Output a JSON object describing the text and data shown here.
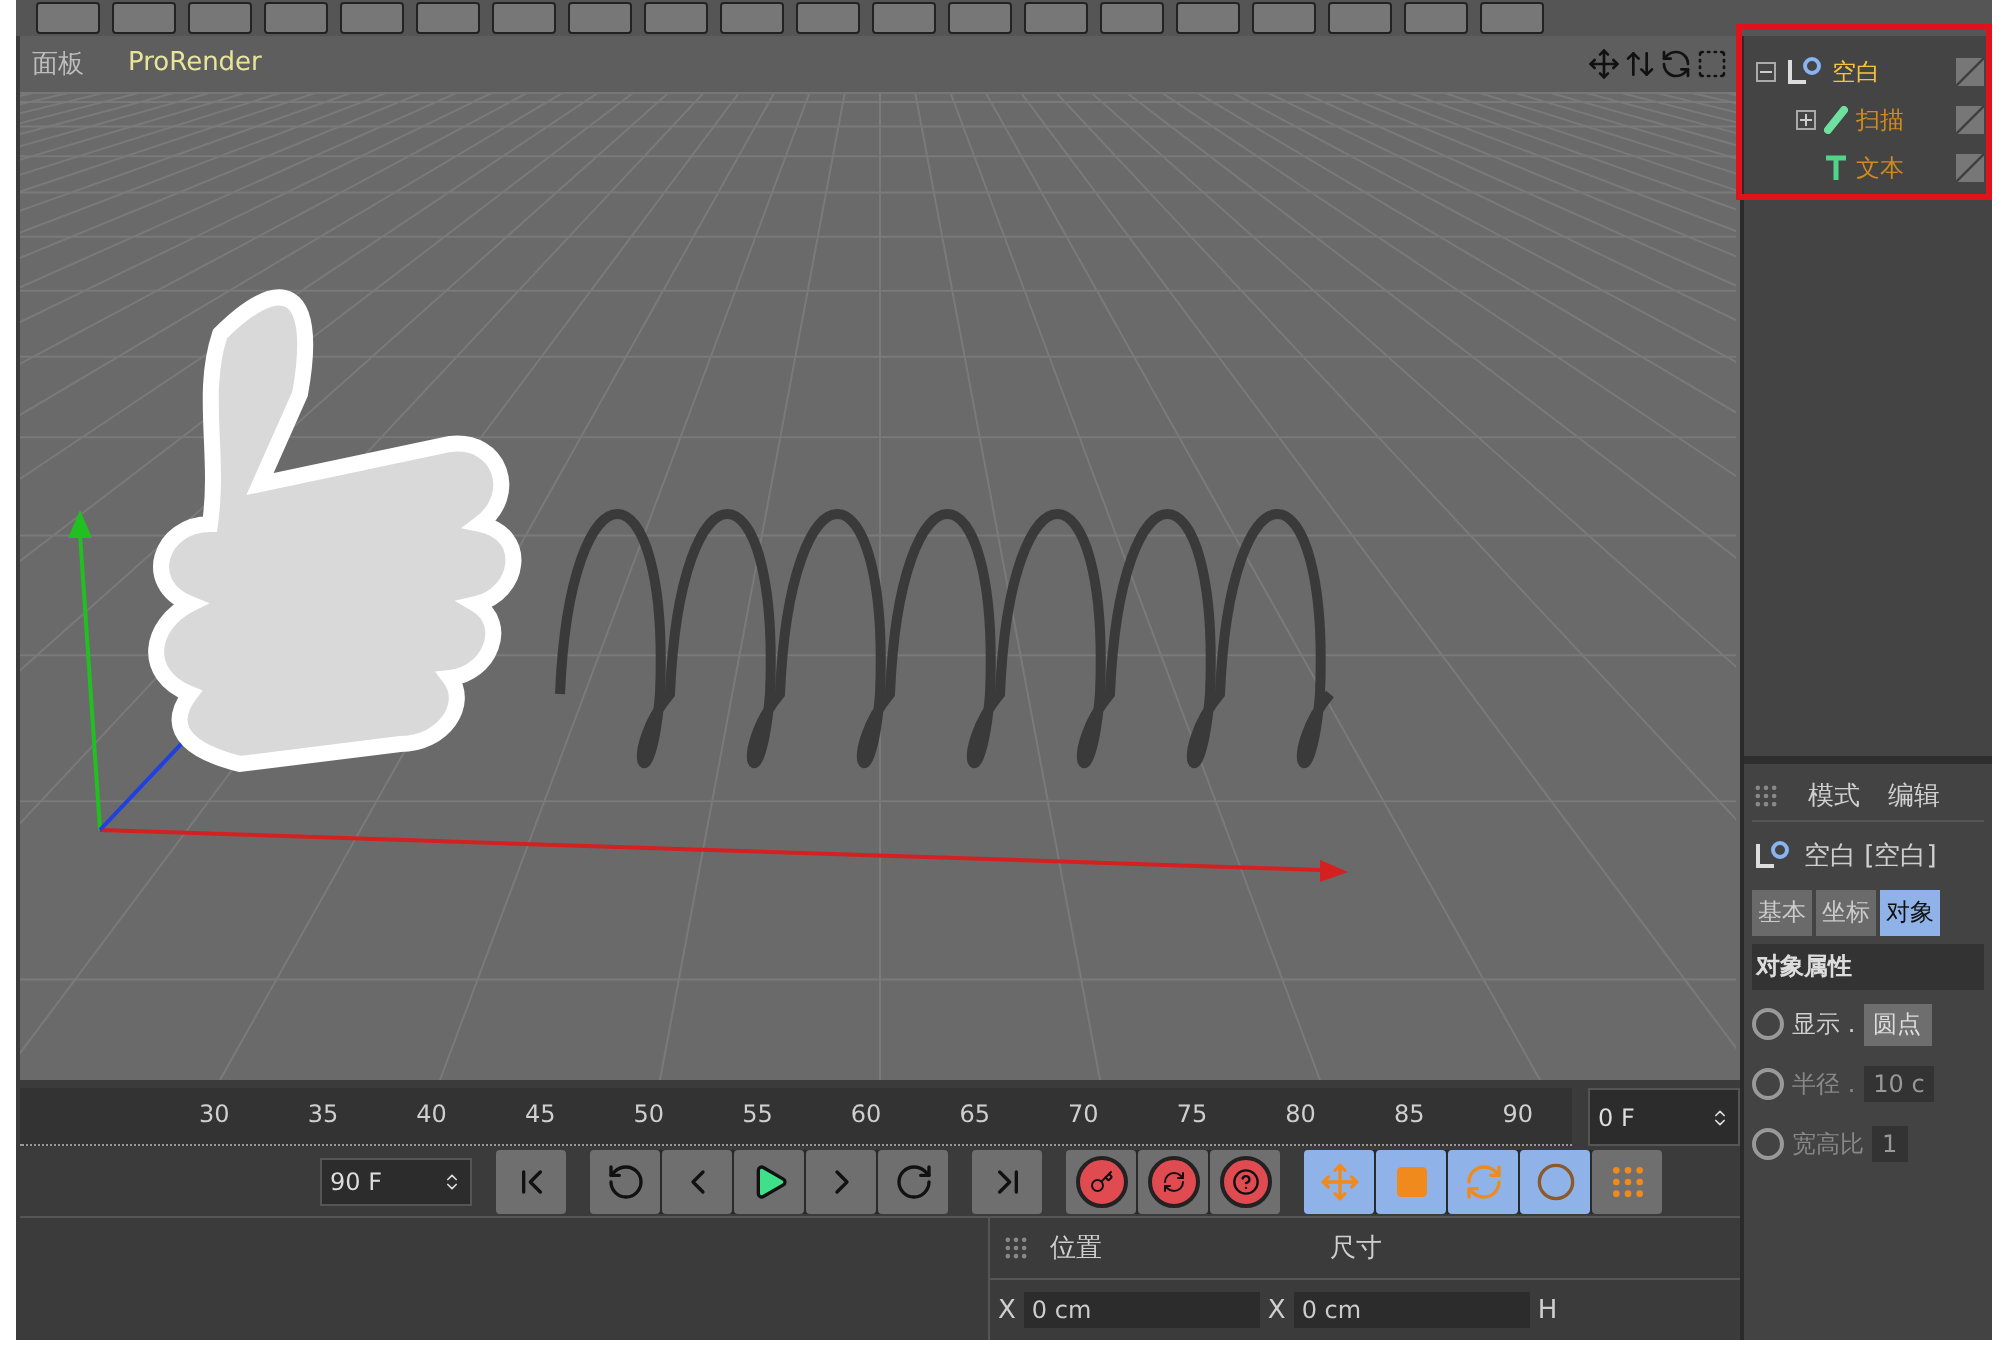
{
  "viewport": {
    "menu": [
      {
        "label": "面板",
        "highlighted": false
      },
      {
        "label": "ProRender",
        "highlighted": true
      }
    ]
  },
  "object_manager": {
    "items": [
      {
        "name": "空白",
        "kind": "null",
        "selected": true,
        "expanded": true,
        "children": [
          {
            "name": "扫描",
            "kind": "sweep",
            "selected": false,
            "expanded": false
          },
          {
            "name": "文本",
            "kind": "text",
            "selected": false
          }
        ]
      }
    ]
  },
  "attributes": {
    "menu": [
      "模式",
      "编辑"
    ],
    "object_title": "空白 [空白]",
    "tabs": [
      {
        "label": "基本",
        "selected": false
      },
      {
        "label": "坐标",
        "selected": false
      },
      {
        "label": "对象",
        "selected": true
      }
    ],
    "section": "对象属性",
    "rows": [
      {
        "label": "显示 .",
        "value": "圆点",
        "kind": "button"
      },
      {
        "label": "半径 .",
        "value": "10 c",
        "kind": "field"
      },
      {
        "label": "宽高比",
        "value": "1",
        "kind": "field"
      }
    ]
  },
  "timeline": {
    "ticks": [
      "30",
      "35",
      "40",
      "45",
      "50",
      "55",
      "60",
      "65",
      "70",
      "75",
      "80",
      "85",
      "90"
    ],
    "current_frame": "0 F",
    "end_frame": "90 F"
  },
  "coordinates": {
    "headers": [
      "位置",
      "尺寸"
    ],
    "fields": [
      {
        "axis": "X",
        "value": "0 cm"
      },
      {
        "axis": "X",
        "value": "0 cm"
      }
    ],
    "column_3": "H"
  }
}
